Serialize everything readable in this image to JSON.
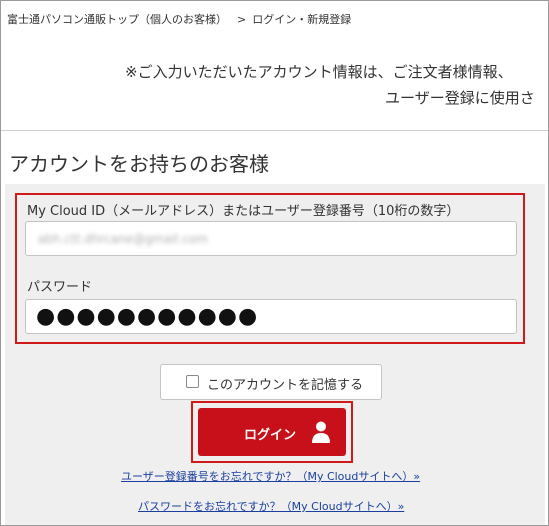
{
  "breadcrumb": {
    "home": "富士通パソコン通販トップ（個人のお客様）",
    "separator": ">",
    "current": "ログイン・新規登録"
  },
  "notice": {
    "line1": "※ご入力いただいたアカウント情報は、ご注文者様情報、",
    "line2": "ユーザー登録に使用さ"
  },
  "login_section": {
    "title": "アカウントをお持ちのお客様",
    "id_label": "My Cloud ID（メールアドレス）またはユーザー登録番号（10桁の数字）",
    "id_value": "abh.ctt.dhrcane@gmail.com",
    "password_label": "パスワード",
    "password_value": "●●●●●●●●●●●",
    "remember_label": "このアカウントを記憶する",
    "remember_checked": false,
    "login_button": "ログイン",
    "login_icon": "user-icon"
  },
  "links": {
    "forgot_user_number": "ユーザー登録番号をお忘れですか？（My Cloudサイトへ）»",
    "forgot_password": "パスワードをお忘れですか？（My Cloudサイトへ）»"
  },
  "colors": {
    "accent": "#c8101a",
    "highlight_border": "#d0191b",
    "link": "#1a3f9e",
    "panel": "#efefef"
  }
}
